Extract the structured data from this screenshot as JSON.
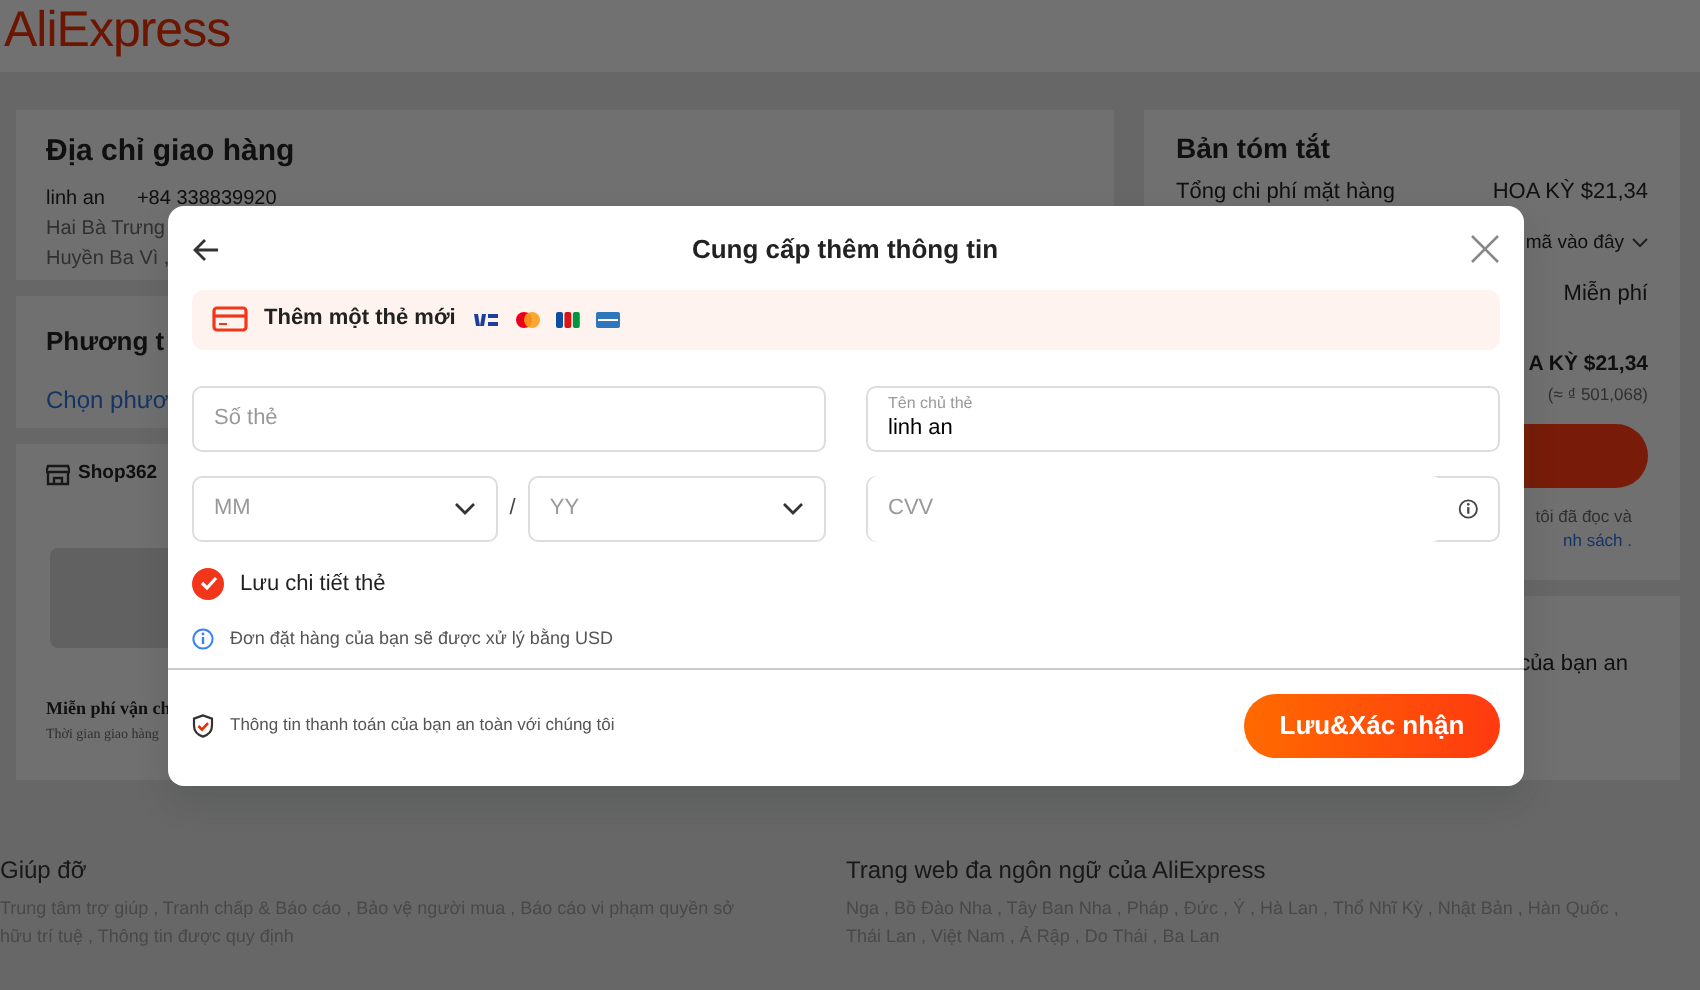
{
  "header": {
    "logo": "AliExpress"
  },
  "shipping": {
    "title": "Địa chỉ giao hàng",
    "name": "linh an",
    "phone": "+84 338839920",
    "address_lines": [
      "Hai Bà Trưng",
      "Huyền Ba Vì ,"
    ]
  },
  "payment": {
    "title": "Phương t",
    "link": "Chọn phươ"
  },
  "shop": {
    "name": "Shop362",
    "shipping_title": "Miễn phí vận ch",
    "delivery_time": "Thời gian giao hàng"
  },
  "summary": {
    "title": "Bản tóm tắt",
    "item_label": "Tổng chi phí mặt hàng",
    "item_value": "HOA KỲ $21,34",
    "coupon_text": "mã vào đây",
    "shipping_value": "Miễn phí",
    "total": "A KỲ $21,34",
    "total_converted": "(≈ ₫ 501,068)",
    "terms_lines": [
      "tôi đã đọc và",
      "nh sách ."
    ]
  },
  "protection": {
    "text": "của bạn an"
  },
  "footer": {
    "columns": [
      {
        "title": "Giúp đỡ",
        "text": "Trung tâm trợ giúp , Tranh chấp & Báo cáo , Bảo vệ người mua , Báo cáo vi phạm quyền sở hữu trí tuệ , Thông tin được quy định"
      },
      {
        "title": "Trang web đa ngôn ngữ của AliExpress",
        "text": "Nga , Bồ Đào Nha , Tây Ban Nha , Pháp , Đức , Ý , Hà Lan , Thổ Nhĩ Kỳ , Nhật Bản , Hàn Quốc , Thái Lan , Việt Nam , Ả Rập , Do Thái , Ba Lan"
      }
    ]
  },
  "modal": {
    "title": "Cung cấp thêm thông tin",
    "banner": "Thêm một thẻ mới",
    "card_number": {
      "placeholder": "Số thẻ"
    },
    "card_holder": {
      "label": "Tên chủ thẻ",
      "value": "linh an"
    },
    "expiry": {
      "month_placeholder": "MM",
      "separator": "/",
      "year_placeholder": "YY"
    },
    "cvv": {
      "placeholder": "CVV"
    },
    "save_card": {
      "label": "Lưu chi tiết thẻ",
      "checked": true
    },
    "currency_note": "Đơn đặt hàng của bạn sẽ được xử lý bằng USD",
    "security_note": "Thông tin thanh toán của bạn an toàn với chúng tôi",
    "submit": "Lưu&Xác nhận"
  }
}
